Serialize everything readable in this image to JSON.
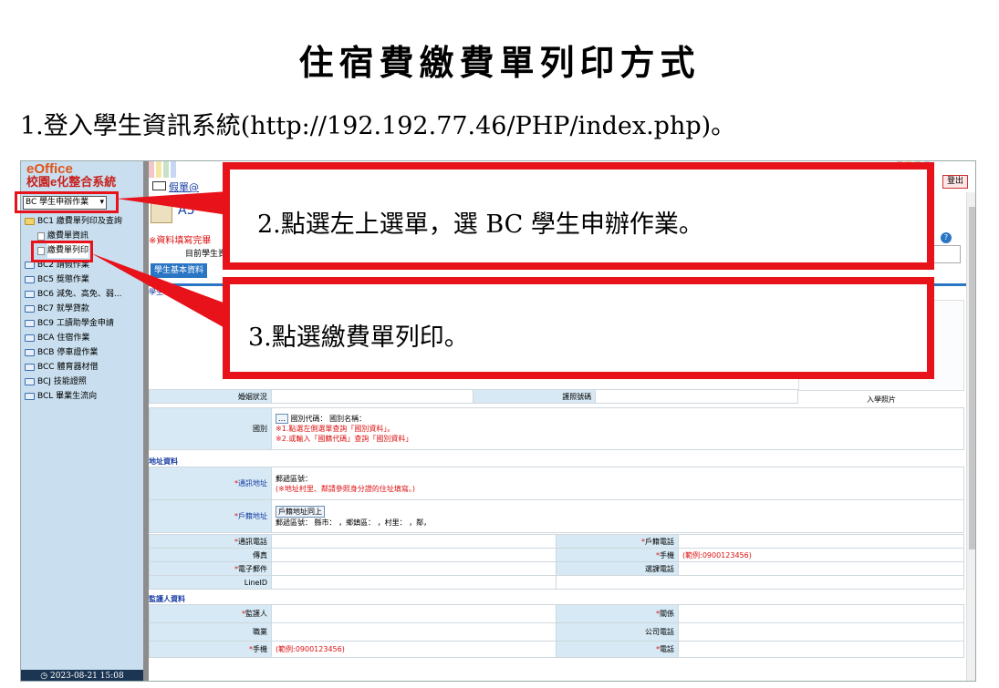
{
  "doc": {
    "title": "住宿費繳費單列印方式",
    "step1": "1.登入學生資訊系統(http://192.192.77.46/PHP/index.php)。",
    "step2": "2.點選左上選單，選 BC 學生申辦作業。",
    "step3": "3.點選繳費單列印。"
  },
  "app": {
    "logo_line1": "eOffice",
    "logo_line2": "校園e化整合系統",
    "menu_select_value": "BC 學生申辦作業",
    "date_time": "2023-08-21 15:08",
    "mail_link": "假單@",
    "logout_label": "登出",
    "program_code": "A5",
    "note_red": "※資料填寫完畢",
    "current_student": "目前學生資",
    "tab_basic": "學生基本資料",
    "tab_other": "",
    "help_icon": "question-icon",
    "colors": {
      "sidebar": "#c9dfef",
      "accent": "#2a76c4",
      "callout": "#e8121b"
    }
  },
  "sidebar": {
    "items": [
      {
        "label": "BC1 繳費單列印及查詢",
        "type": "folder-open"
      },
      {
        "label": "繳費單資訊",
        "type": "doc",
        "level": 1
      },
      {
        "label": "繳費單列印",
        "type": "doc",
        "level": 1,
        "highlight": true
      },
      {
        "label": "BC2 請假作業",
        "type": "folder"
      },
      {
        "label": "BC5 獎懲作業",
        "type": "folder"
      },
      {
        "label": "BC6 減免、高免、弱...",
        "type": "folder"
      },
      {
        "label": "BC7 就學貸款",
        "type": "folder"
      },
      {
        "label": "BC9 工讀助學金申請",
        "type": "folder"
      },
      {
        "label": "BCA 住宿作業",
        "type": "folder"
      },
      {
        "label": "BCB 停車證作業",
        "type": "folder"
      },
      {
        "label": "BCC 體育器材借",
        "type": "folder"
      },
      {
        "label": "BCJ 技能證照",
        "type": "folder"
      },
      {
        "label": "BCL 畢業生流向",
        "type": "folder"
      }
    ]
  },
  "form": {
    "section_student": "學生",
    "marital_label": "婚姻狀況",
    "id_no_label": "護照號碼",
    "photo_label": "入學照片",
    "country_label": "國別",
    "country_text": "國別代碼： 國別名稱：",
    "country_note1": "※1.點選左側選單查詢「國別資料」。",
    "country_note2": "※2.或輸入「國籍代碼」查詢「國別資料」",
    "section_address": "地址資料",
    "mail_addr_label": "通訊地址",
    "mail_addr_text": "郵遞區號：",
    "mail_addr_note": "(※地址村里、鄰請參照身分證的住址填寫。)",
    "reg_addr_label": "戶籍地址",
    "reg_addr_btn": "戶籍地址同上",
    "reg_addr_text": "郵遞區號： 縣市： ，鄉鎮區： ，村里： ，鄰，",
    "comm_phone_label": "通訊電話",
    "reg_phone_label": "戶籍電話",
    "fax_label": "傳真",
    "mobile_label": "手機",
    "mobile_hint": "(範例:0900123456)",
    "email_label": "電子郵件",
    "class_phone_label": "選課電話",
    "lineid_label": "LineID",
    "section_guardian": "監護人資料",
    "guardian_label": "監護人",
    "relation_label": "關係",
    "job_label": "職業",
    "company_phone_label": "公司電話",
    "g_mobile_label": "手機",
    "g_mobile_hint": "(範例:0900123456)",
    "g_phone_label": "電話"
  }
}
